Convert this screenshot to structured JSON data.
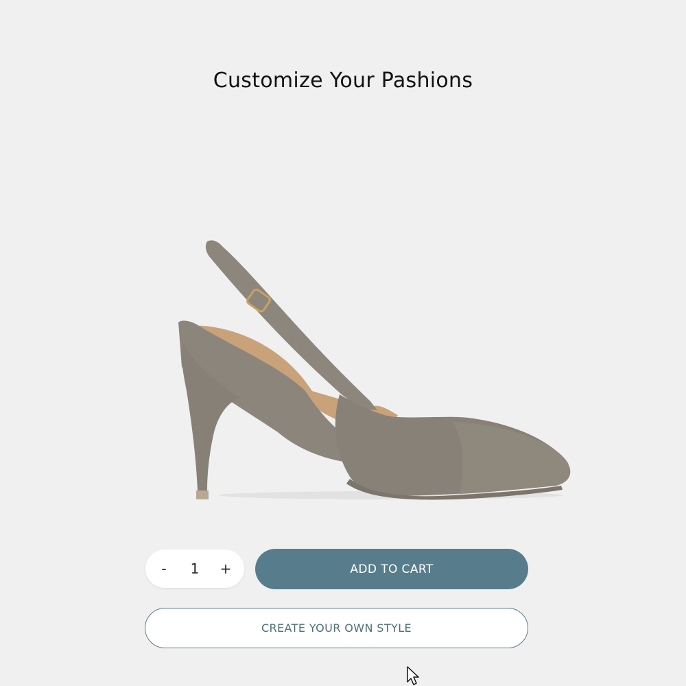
{
  "page": {
    "title": "Customize Your Pashions"
  },
  "product": {
    "image_icon": "shoe-slingback-heel-image",
    "color": "#8a8379"
  },
  "quantity": {
    "decrement_label": "-",
    "value": "1",
    "increment_label": "+"
  },
  "actions": {
    "add_to_cart_label": "ADD TO CART",
    "create_style_label": "CREATE YOUR OWN STYLE"
  },
  "colors": {
    "background": "#f0f0f0",
    "primary_button": "#577d8d",
    "outline_button_border": "#577d8d",
    "outline_button_text": "#4d6f78"
  },
  "cursor": {
    "icon": "mouse-pointer-icon"
  }
}
